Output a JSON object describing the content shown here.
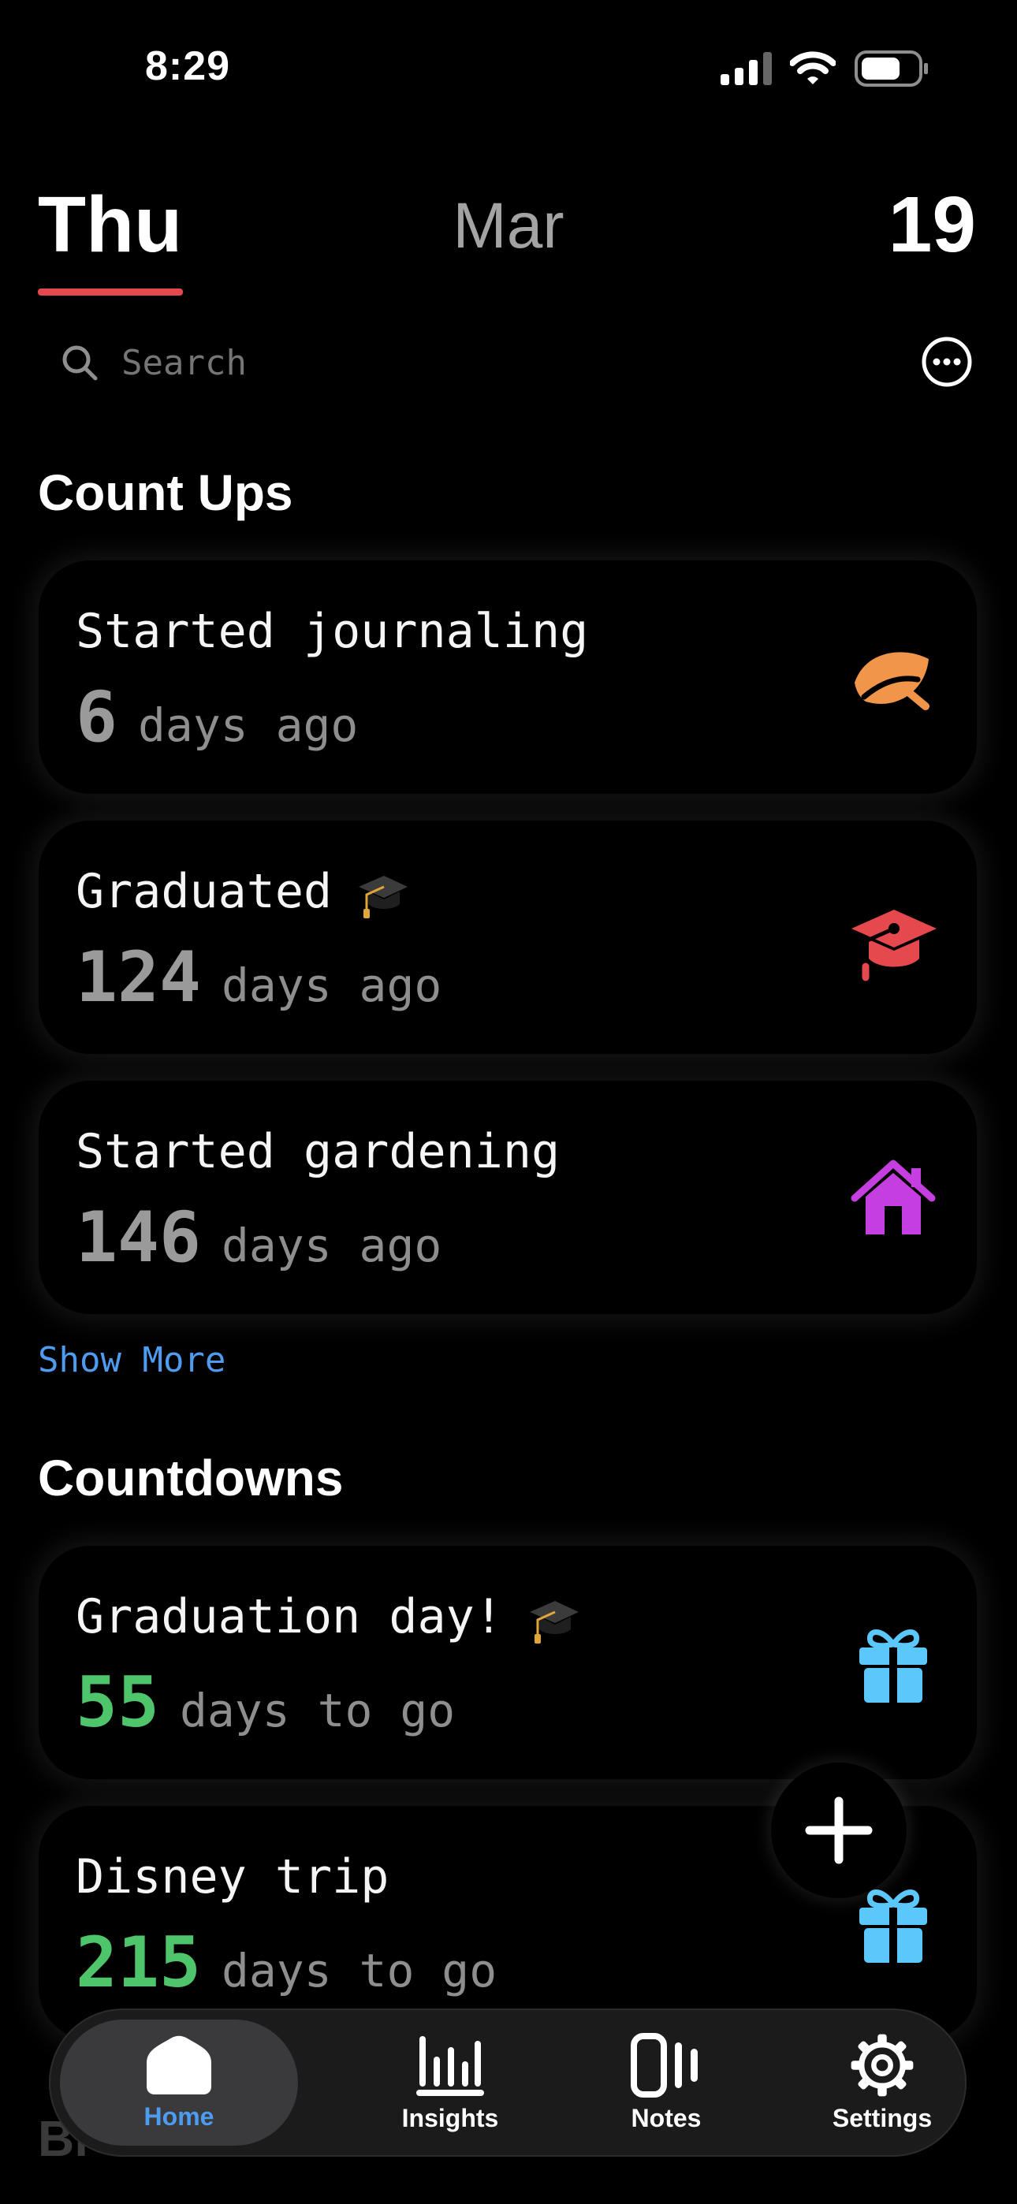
{
  "status_bar": {
    "time": "8:29"
  },
  "header": {
    "day": "Thu",
    "month": "Mar",
    "date": "19"
  },
  "search": {
    "placeholder": "Search"
  },
  "count_ups": {
    "title": "Count Ups",
    "items": [
      {
        "title": "Started journaling",
        "number": "6",
        "unit": "days ago",
        "icon": "leaf-icon",
        "color": "#f0954a"
      },
      {
        "title": "Graduated",
        "title_emoji": "graduation-cap-emoji",
        "number": "124",
        "unit": "days ago",
        "icon": "graduation-cap-icon",
        "color": "#e5484d"
      },
      {
        "title": "Started gardening",
        "number": "146",
        "unit": "days ago",
        "icon": "house-icon",
        "color": "#c53ee0"
      }
    ],
    "show_more": "Show More"
  },
  "countdowns": {
    "title": "Countdowns",
    "items": [
      {
        "title": "Graduation day!",
        "title_emoji": "graduation-cap-emoji",
        "number": "55",
        "unit": "days to go",
        "icon": "gift-icon",
        "color": "#5ac8fa"
      },
      {
        "title": "Disney trip",
        "number": "215",
        "unit": "days to go",
        "icon": "gift-icon",
        "color": "#5ac8fa"
      }
    ]
  },
  "partially_hidden_section": "Bi",
  "tabbar": {
    "items": [
      {
        "label": "Home",
        "icon": "home-icon",
        "active": true
      },
      {
        "label": "Insights",
        "icon": "bar-chart-icon",
        "active": false
      },
      {
        "label": "Notes",
        "icon": "notes-icon",
        "active": false
      },
      {
        "label": "Settings",
        "icon": "gear-icon",
        "active": false
      }
    ]
  },
  "colors": {
    "accent_red": "#e5484d",
    "link_blue": "#4d9cf0",
    "countdown_green": "#4ec46b"
  }
}
